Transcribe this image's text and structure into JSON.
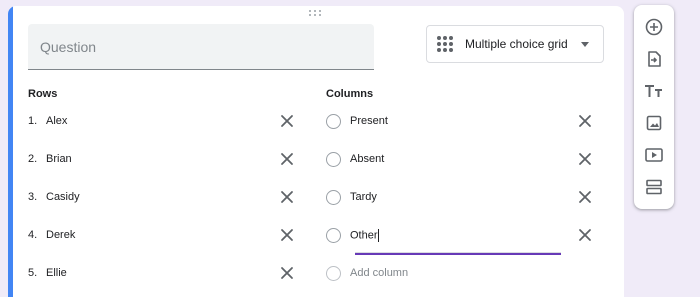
{
  "question": {
    "placeholder": "Question",
    "value": ""
  },
  "question_type": {
    "label": "Multiple choice grid",
    "icon": "grid-dots-icon"
  },
  "rows": {
    "title": "Rows",
    "items": [
      {
        "number": "1.",
        "label": "Alex"
      },
      {
        "number": "2.",
        "label": "Brian"
      },
      {
        "number": "3.",
        "label": "Casidy"
      },
      {
        "number": "4.",
        "label": "Derek"
      },
      {
        "number": "5.",
        "label": "Ellie"
      }
    ]
  },
  "columns": {
    "title": "Columns",
    "items": [
      {
        "label": "Present"
      },
      {
        "label": "Absent"
      },
      {
        "label": "Tardy"
      },
      {
        "label": "Other"
      }
    ],
    "add_label": "Add column"
  },
  "toolbar": {
    "items": [
      {
        "icon": "add-circle-icon"
      },
      {
        "icon": "import-questions-icon"
      },
      {
        "icon": "title-text-icon"
      },
      {
        "icon": "image-icon"
      },
      {
        "icon": "video-icon"
      },
      {
        "icon": "section-icon"
      }
    ]
  },
  "colors": {
    "accent": "#4285f4",
    "active_underline": "#673ab7",
    "background": "#f0ebf8"
  }
}
